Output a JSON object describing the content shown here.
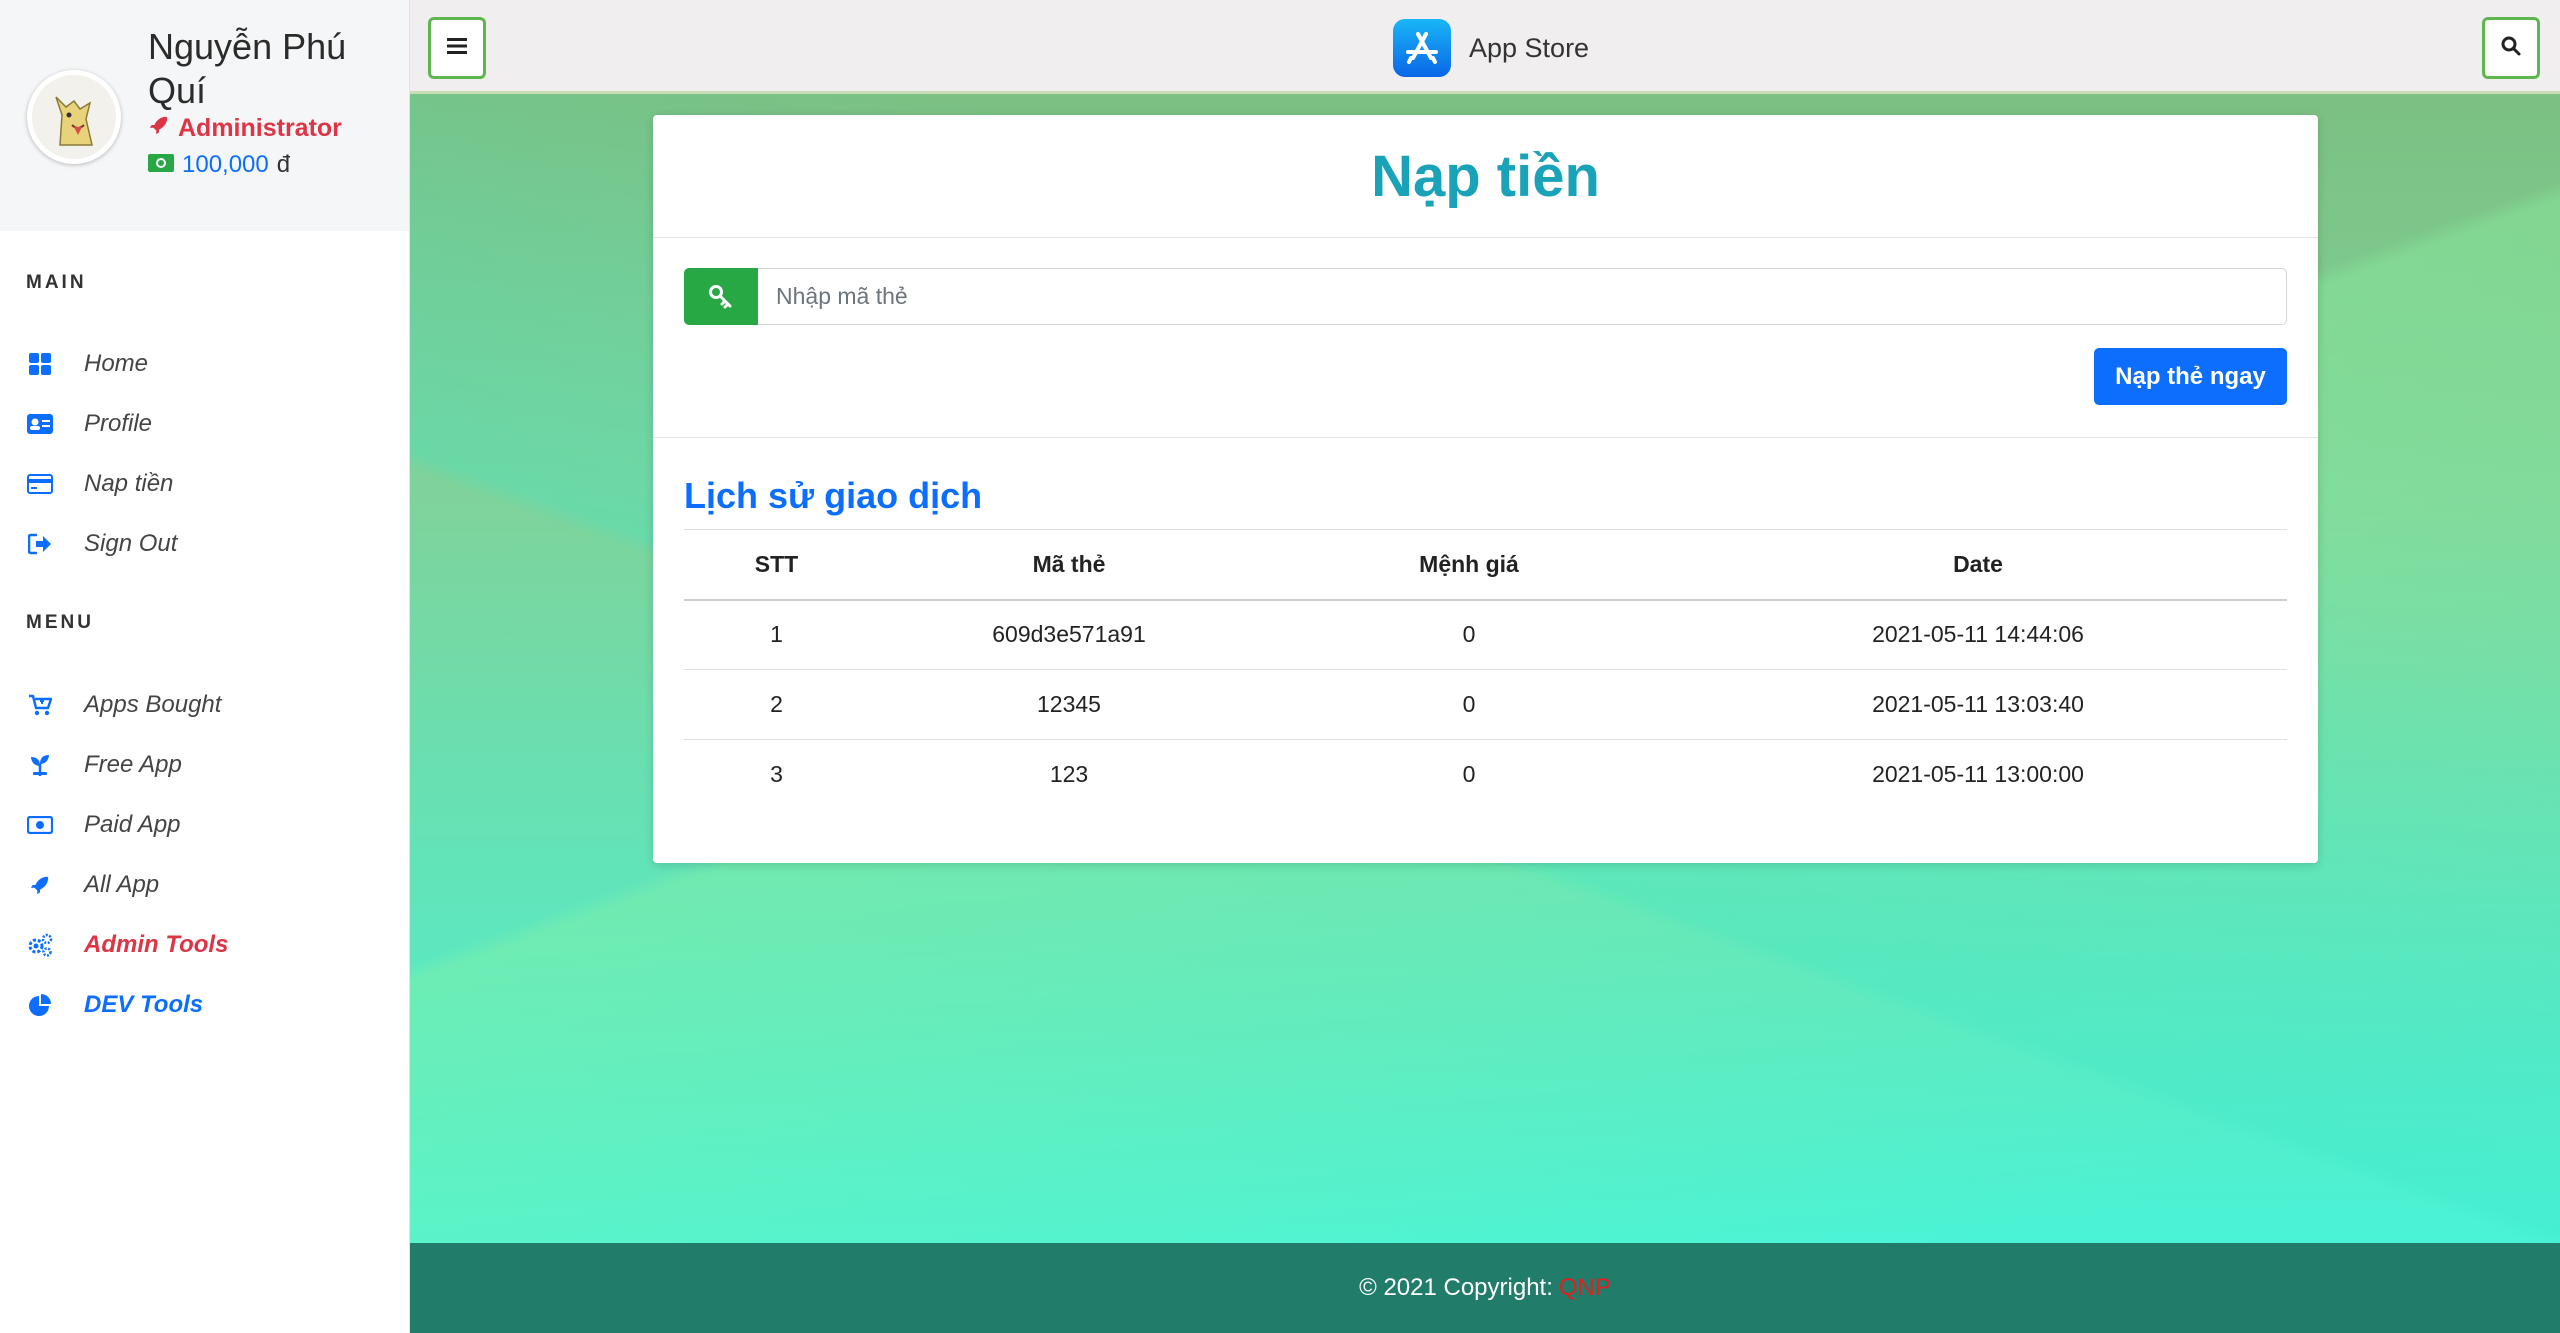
{
  "sidebar": {
    "user": {
      "name": "Nguyễn Phú Quí",
      "role": "Administrator",
      "balance": "100,000",
      "currency": "đ"
    },
    "sections": [
      {
        "heading": "MAIN"
      },
      {
        "heading": "MENU"
      }
    ],
    "main_items": [
      {
        "label": "Home",
        "icon": "grid-icon"
      },
      {
        "label": "Profile",
        "icon": "id-card-icon"
      },
      {
        "label": "Nap tiền",
        "icon": "credit-card-icon"
      },
      {
        "label": "Sign Out",
        "icon": "sign-out-icon"
      }
    ],
    "menu_items": [
      {
        "label": "Apps Bought",
        "icon": "cart-icon"
      },
      {
        "label": "Free App",
        "icon": "seedling-icon"
      },
      {
        "label": "Paid App",
        "icon": "money-bill-icon"
      },
      {
        "label": "All App",
        "icon": "rocket-icon"
      },
      {
        "label": "Admin Tools",
        "icon": "cogs-icon"
      },
      {
        "label": "DEV Tools",
        "icon": "pie-chart-icon"
      }
    ]
  },
  "topbar": {
    "brand": "App Store"
  },
  "card": {
    "title": "Nạp tiền",
    "input_placeholder": "Nhập mã thẻ",
    "submit_label": "Nạp thẻ ngay",
    "history_title": "Lịch sử giao dịch",
    "table": {
      "headers": [
        "STT",
        "Mã thẻ",
        "Mệnh giá",
        "Date"
      ],
      "rows": [
        [
          "1",
          "609d3e571a91",
          "0",
          "2021-05-11 14:44:06"
        ],
        [
          "2",
          "12345",
          "0",
          "2021-05-11 13:03:40"
        ],
        [
          "3",
          "123",
          "0",
          "2021-05-11 13:00:00"
        ]
      ]
    }
  },
  "footer": {
    "copyright": "© 2021 Copyright:",
    "brand": "QNP"
  },
  "colors": {
    "accent": "#0d6efd",
    "title": "#1aa3b8",
    "danger": "#dc3545",
    "success": "#28a745",
    "footer": "#217d69"
  }
}
